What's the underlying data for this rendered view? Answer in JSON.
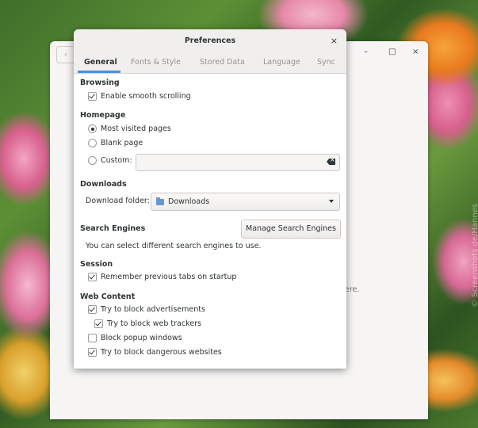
{
  "desktop": {
    "watermark": "© Screenshots.de/Hannes"
  },
  "background_window": {
    "back_icon": "chevron-left-icon",
    "minimize": "–",
    "maximize": "□",
    "close": "×",
    "partial_text": "ere."
  },
  "dialog": {
    "title": "Preferences",
    "close_label": "×",
    "tabs": [
      {
        "label": "General",
        "active": true
      },
      {
        "label": "Fonts & Style",
        "active": false
      },
      {
        "label": "Stored Data",
        "active": false
      },
      {
        "label": "Language",
        "active": false
      },
      {
        "label": "Sync",
        "active": false
      }
    ],
    "browsing": {
      "title": "Browsing",
      "smooth_scrolling": {
        "label": "Enable smooth scrolling",
        "checked": true
      }
    },
    "homepage": {
      "title": "Homepage",
      "options": [
        {
          "label": "Most visited pages",
          "selected": true
        },
        {
          "label": "Blank page",
          "selected": false
        },
        {
          "label": "Custom:",
          "selected": false
        }
      ],
      "custom_value": ""
    },
    "downloads": {
      "title": "Downloads",
      "folder_label": "Download folder:",
      "folder_value": "Downloads"
    },
    "search_engines": {
      "title": "Search Engines",
      "button_label": "Manage Search Engines",
      "description": "You can select different search engines to use."
    },
    "session": {
      "title": "Session",
      "remember_tabs": {
        "label": "Remember previous tabs on startup",
        "checked": true
      }
    },
    "web_content": {
      "title": "Web Content",
      "block_ads": {
        "label": "Try to block advertisements",
        "checked": true
      },
      "block_trackers": {
        "label": "Try to block web trackers",
        "checked": true
      },
      "block_popups": {
        "label": "Block popup windows",
        "checked": false
      },
      "block_dangerous": {
        "label": "Try to block dangerous websites",
        "checked": true
      }
    }
  }
}
